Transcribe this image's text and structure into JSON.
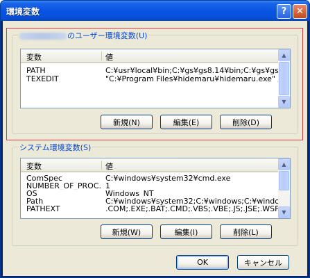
{
  "window": {
    "title": "環境変数"
  },
  "titlebar": {
    "help_glyph": "?",
    "close_glyph": "✕"
  },
  "user_group": {
    "title": "のユーザー環境変数(U)",
    "columns": [
      "変数",
      "値"
    ],
    "rows": [
      {
        "name": "PATH",
        "value": "C:¥usr¥local¥bin;C:¥gs¥gs8.14¥bin;C:¥gs¥gs8.1..."
      },
      {
        "name": "TEXEDIT",
        "value": "\"C:¥Program Files¥hidemaru¥hidemaru.exe\" /j..."
      }
    ],
    "buttons": {
      "new": "新規(N)",
      "edit": "編集(E)",
      "delete": "削除(D)"
    }
  },
  "system_group": {
    "title": "システム環境変数(S)",
    "columns": [
      "変数",
      "値"
    ],
    "rows": [
      {
        "name": "ComSpec",
        "value": "C:¥windows¥system32¥cmd.exe"
      },
      {
        "name": "NUMBER_OF_PROC...",
        "value": "1"
      },
      {
        "name": "OS",
        "value": "Windows_NT"
      },
      {
        "name": "Path",
        "value": "C:¥windows¥system32;C:¥windows;C:¥windows..."
      },
      {
        "name": "PATHEXT",
        "value": ".COM;.EXE;.BAT;.CMD;.VBS;.VBE;.JS;.JSE;.WSF;..."
      }
    ],
    "buttons": {
      "new": "新規(W)",
      "edit": "編集(I)",
      "delete": "削除(L)"
    }
  },
  "footer": {
    "ok": "OK",
    "cancel": "キャンセル"
  },
  "colors": {
    "title_blue": "#0a55e4",
    "highlight_red": "#d43c3c",
    "group_title": "#0046d5",
    "dialog_bg": "#ece9d8"
  }
}
